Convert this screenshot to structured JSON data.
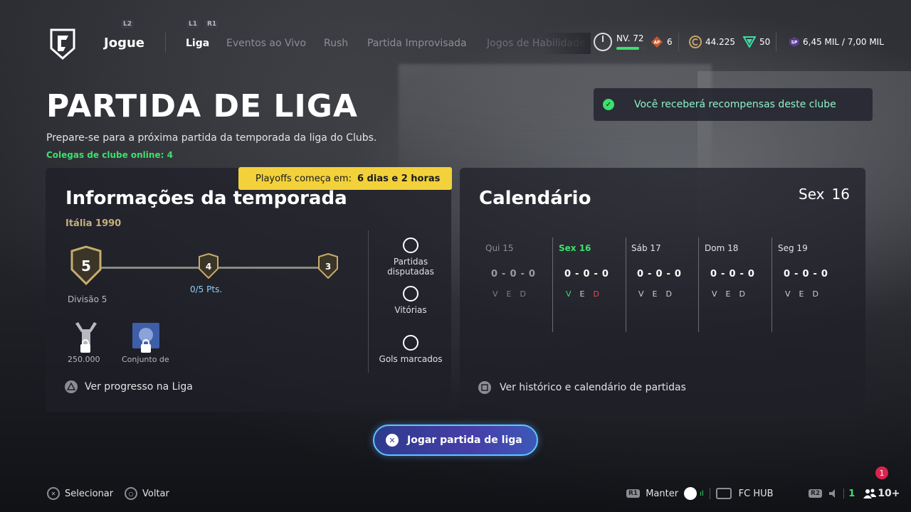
{
  "nav": {
    "hint_l2": "L2",
    "hint_l1": "L1",
    "hint_r1": "R1",
    "play_label": "Jogue",
    "tabs": [
      {
        "label": "Liga",
        "active": true
      },
      {
        "label": "Eventos ao Vivo",
        "active": false
      },
      {
        "label": "Rush",
        "active": false
      },
      {
        "label": "Partida Improvisada",
        "active": false
      },
      {
        "label": "Jogos de Habilidade",
        "active": false
      }
    ]
  },
  "status": {
    "level": "NV. 72",
    "level_progress": 0.75,
    "ap_badge": "AP",
    "ap_value": "6",
    "coins": "44.225",
    "points": "50",
    "sp_badge": "SP",
    "sp_value": "6,45 MIL / 7,00 MIL"
  },
  "header": {
    "title": "PARTIDA DE LIGA",
    "subtitle": "Prepare-se para a próxima partida da temporada da liga do Clubs.",
    "online": "Colegas de clube online: 4"
  },
  "notice": "Você receberá recompensas deste clube",
  "playoffs": {
    "label": "Playoffs começa em:",
    "value": "6 dias e 2 horas"
  },
  "season": {
    "heading": "Informações da temporada",
    "name": "Itália 1990",
    "divisions": {
      "current": "5",
      "next": "4",
      "after": "3"
    },
    "division_label": "Divisão 5",
    "points": "0/5 Pts.",
    "reward_coins": "250.000",
    "reward_kit": "Conjunto de",
    "stats": [
      "Partidas disputadas",
      "Vitórias",
      "Gols marcados"
    ],
    "progress_link": "Ver progresso na Liga"
  },
  "calendar": {
    "heading": "Calendário",
    "today_day": "Sex",
    "today_num": "16",
    "days": [
      {
        "label": "Qui 15",
        "score": "0-0-0",
        "v": "V",
        "e": "E",
        "d": "D"
      },
      {
        "label": "Sex 16",
        "score": "0-0-0",
        "v": "V",
        "e": "E",
        "d": "D"
      },
      {
        "label": "Sáb 17",
        "score": "0-0-0",
        "v": "V",
        "e": "E",
        "d": "D"
      },
      {
        "label": "Dom 18",
        "score": "0-0-0",
        "v": "V",
        "e": "E",
        "d": "D"
      },
      {
        "label": "Seg 19",
        "score": "0-0-0",
        "v": "V",
        "e": "E",
        "d": "D"
      }
    ],
    "history_link": "Ver histórico e calendário de partidas"
  },
  "play_button": "Jogar partida de liga",
  "footer": {
    "select": "Selecionar",
    "back": "Voltar",
    "r1": "R1",
    "hold": "Manter",
    "hub": "FC HUB",
    "r2": "R2",
    "count": "1",
    "friends": "10+",
    "notifications": "1"
  }
}
